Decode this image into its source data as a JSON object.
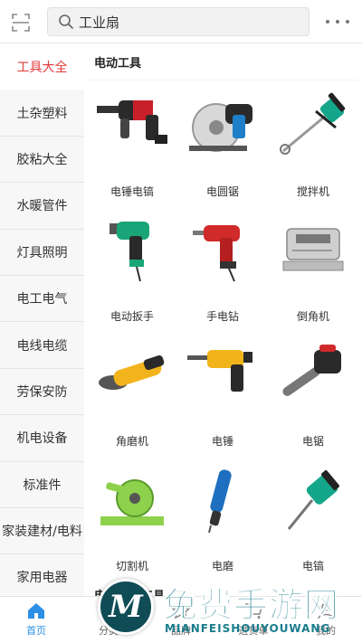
{
  "search": {
    "query": "工业扇"
  },
  "sidebar": {
    "items": [
      {
        "label": "工具大全",
        "active": true
      },
      {
        "label": "土杂塑料"
      },
      {
        "label": "胶粘大全"
      },
      {
        "label": "水暖管件"
      },
      {
        "label": "灯具照明"
      },
      {
        "label": "电工电气"
      },
      {
        "label": "电线电缆"
      },
      {
        "label": "劳保安防"
      },
      {
        "label": "机电设备"
      },
      {
        "label": "标准件"
      },
      {
        "label": "家装建材/电料"
      },
      {
        "label": "家用电器"
      }
    ]
  },
  "content": {
    "section_title": "电动工具",
    "products": [
      {
        "label": "电锤电镐",
        "icon": "rotary-hammer-icon"
      },
      {
        "label": "电圆锯",
        "icon": "circular-saw-icon"
      },
      {
        "label": "搅拌机",
        "icon": "mixer-drill-icon"
      },
      {
        "label": "电动扳手",
        "icon": "impact-wrench-icon"
      },
      {
        "label": "手电钻",
        "icon": "hand-drill-icon"
      },
      {
        "label": "倒角机",
        "icon": "chamfering-machine-icon"
      },
      {
        "label": "角磨机",
        "icon": "angle-grinder-icon"
      },
      {
        "label": "电锤",
        "icon": "electric-hammer-icon"
      },
      {
        "label": "电锯",
        "icon": "chainsaw-icon"
      },
      {
        "label": "切割机",
        "icon": "cut-off-saw-icon"
      },
      {
        "label": "电磨",
        "icon": "die-grinder-icon"
      },
      {
        "label": "电镐",
        "icon": "demolition-hammer-icon"
      }
    ],
    "next_section_title": "电动园林工具"
  },
  "bottom_nav": {
    "items": [
      {
        "label": "首页",
        "icon": "home-icon",
        "active": true
      },
      {
        "label": "分类",
        "icon": "category-icon"
      },
      {
        "label": "品牌",
        "icon": "brand-icon"
      },
      {
        "label": "进货单",
        "icon": "cart-icon"
      },
      {
        "label": "我的",
        "icon": "user-icon"
      }
    ]
  },
  "watermark": {
    "logo_letter": "M",
    "title": "免费手游网",
    "subtitle": "MIANFEISHOUYOUWANG"
  },
  "colors": {
    "accent_red": "#e33b3b",
    "nav_active_blue": "#2b8fe6",
    "watermark_teal": "#1a7c8c"
  }
}
